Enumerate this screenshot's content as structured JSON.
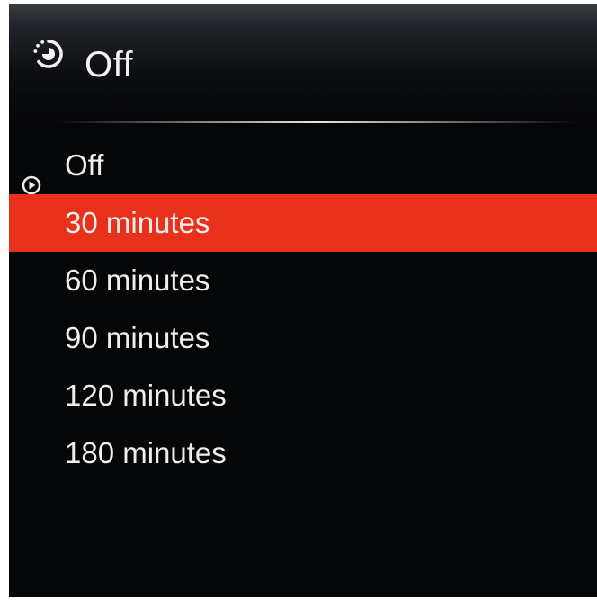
{
  "header": {
    "icon": "sleep-timer-icon",
    "title": "Off"
  },
  "options": [
    {
      "label": "Off",
      "current": true,
      "highlighted": false
    },
    {
      "label": "30 minutes",
      "current": false,
      "highlighted": true
    },
    {
      "label": "60 minutes",
      "current": false,
      "highlighted": false
    },
    {
      "label": "90 minutes",
      "current": false,
      "highlighted": false
    },
    {
      "label": "120 minutes",
      "current": false,
      "highlighted": false
    },
    {
      "label": "180 minutes",
      "current": false,
      "highlighted": false
    }
  ],
  "current_marker_icon": "play-circle-icon",
  "colors": {
    "background": "#050608",
    "highlight": "#e8311a",
    "text": "#eeeeee"
  }
}
